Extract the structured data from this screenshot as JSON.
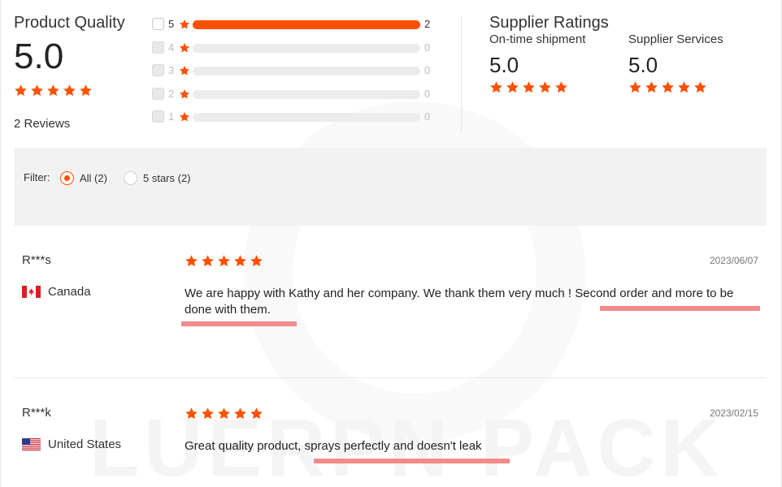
{
  "product_quality": {
    "title": "Product Quality",
    "score": "5.0",
    "stars": 5,
    "reviews_label": "2 Reviews"
  },
  "rating_breakdown": [
    {
      "stars": "5",
      "count": "2",
      "fraction": 1.0
    },
    {
      "stars": "4",
      "count": "0",
      "fraction": 0
    },
    {
      "stars": "3",
      "count": "0",
      "fraction": 0
    },
    {
      "stars": "2",
      "count": "0",
      "fraction": 0
    },
    {
      "stars": "1",
      "count": "0",
      "fraction": 0
    }
  ],
  "supplier_ratings": {
    "title": "Supplier Ratings",
    "items": [
      {
        "label": "On-time shipment",
        "score": "5.0",
        "stars": 5
      },
      {
        "label": "Supplier Services",
        "score": "5.0",
        "stars": 5
      }
    ]
  },
  "filter": {
    "label": "Filter:",
    "options": [
      {
        "label": "All (2)",
        "selected": true
      },
      {
        "label": "5 stars (2)",
        "selected": false
      }
    ]
  },
  "reviews": [
    {
      "name": "R***s",
      "country": "Canada",
      "flag_icon": "canada-flag-icon",
      "stars": 5,
      "date": "2023/06/07",
      "text": "We are happy with Kathy and her company. We thank them very much ! Second order and more to be done with them."
    },
    {
      "name": "R***k",
      "country": "United States",
      "flag_icon": "usa-flag-icon",
      "stars": 5,
      "date": "2023/02/15",
      "text": "Great quality product, sprays perfectly and doesn't leak"
    }
  ],
  "watermark_text": "LUERPN PACK",
  "colors": {
    "accent": "#ff5000",
    "highlight": "#f28b8b",
    "filter_bg": "#f2f2f2"
  }
}
